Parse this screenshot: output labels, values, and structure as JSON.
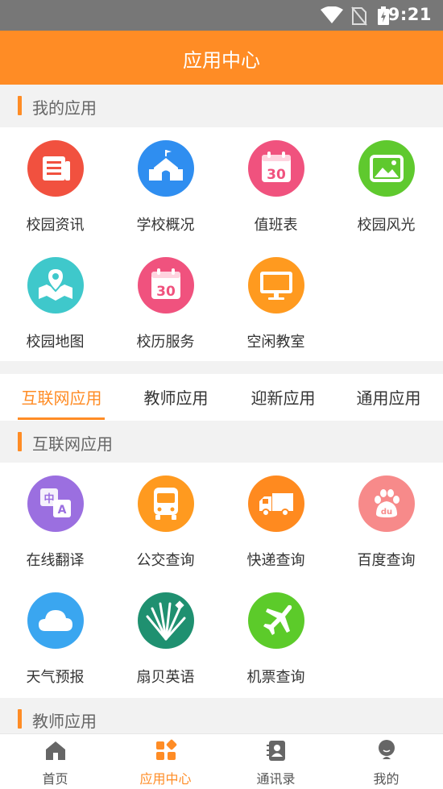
{
  "status": {
    "time": "9:21"
  },
  "header": {
    "title": "应用中心"
  },
  "my_apps": {
    "title": "我的应用",
    "items": [
      {
        "label": "校园资讯",
        "icon": "news-icon",
        "color": "#f1513f"
      },
      {
        "label": "学校概况",
        "icon": "school-icon",
        "color": "#2f8ef0"
      },
      {
        "label": "值班表",
        "icon": "calendar-icon",
        "color": "#f0527e"
      },
      {
        "label": "校园风光",
        "icon": "image-icon",
        "color": "#5fc92e"
      },
      {
        "label": "校园地图",
        "icon": "map-icon",
        "color": "#3fc8cb"
      },
      {
        "label": "校历服务",
        "icon": "calendar-icon",
        "color": "#f0527e"
      },
      {
        "label": "空闲教室",
        "icon": "monitor-icon",
        "color": "#ff9a1f"
      }
    ]
  },
  "tabs": {
    "items": [
      {
        "label": "互联网应用"
      },
      {
        "label": "教师应用"
      },
      {
        "label": "迎新应用"
      },
      {
        "label": "通用应用"
      }
    ]
  },
  "internet_apps": {
    "title": "互联网应用",
    "items": [
      {
        "label": "在线翻译",
        "icon": "translate-icon",
        "color": "#9b6fe0"
      },
      {
        "label": "公交查询",
        "icon": "bus-icon",
        "color": "#ff9a1f"
      },
      {
        "label": "快递查询",
        "icon": "truck-icon",
        "color": "#ff8a1f"
      },
      {
        "label": "百度查询",
        "icon": "baidu-icon",
        "color": "#f78a8a"
      },
      {
        "label": "天气预报",
        "icon": "cloud-icon",
        "color": "#3aa6f0"
      },
      {
        "label": "扇贝英语",
        "icon": "shanbay-icon",
        "color": "#1f9070"
      },
      {
        "label": "机票查询",
        "icon": "plane-icon",
        "color": "#5ccb2a"
      }
    ]
  },
  "teacher_apps": {
    "title": "教师应用"
  },
  "calendar_day": "30",
  "bottom_nav": {
    "items": [
      {
        "label": "首页",
        "icon": "home-icon"
      },
      {
        "label": "应用中心",
        "icon": "apps-icon"
      },
      {
        "label": "通讯录",
        "icon": "contacts-icon"
      },
      {
        "label": "我的",
        "icon": "profile-icon"
      }
    ]
  }
}
